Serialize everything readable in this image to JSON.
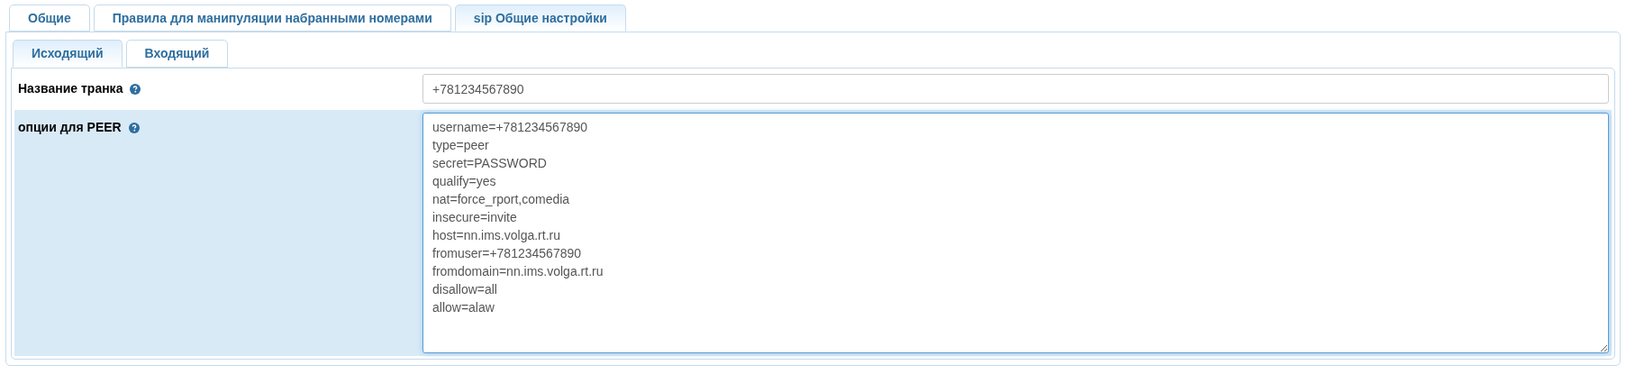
{
  "tabs": [
    {
      "label": "Общие",
      "selected": false
    },
    {
      "label": "Правила для манипуляции набранными номерами",
      "selected": false
    },
    {
      "label": "sip Общие настройки",
      "selected": true
    }
  ],
  "subtabs": [
    {
      "label": "Исходящий",
      "selected": true
    },
    {
      "label": "Входящий",
      "selected": false
    }
  ],
  "rows": [
    {
      "label": "Название транка",
      "highlighted": false,
      "kind": "input",
      "value": "+781234567890",
      "focused": false
    },
    {
      "label": "опции для PEER",
      "highlighted": true,
      "kind": "textarea",
      "value": "username=+781234567890\ntype=peer\nsecret=PASSWORD\nqualify=yes\nnat=force_rport,comedia\ninsecure=invite\nhost=nn.ims.volga.rt.ru\nfromuser=+781234567890\nfromdomain=nn.ims.volga.rt.ru\ndisallow=all\nallow=alaw",
      "focused": true
    }
  ]
}
